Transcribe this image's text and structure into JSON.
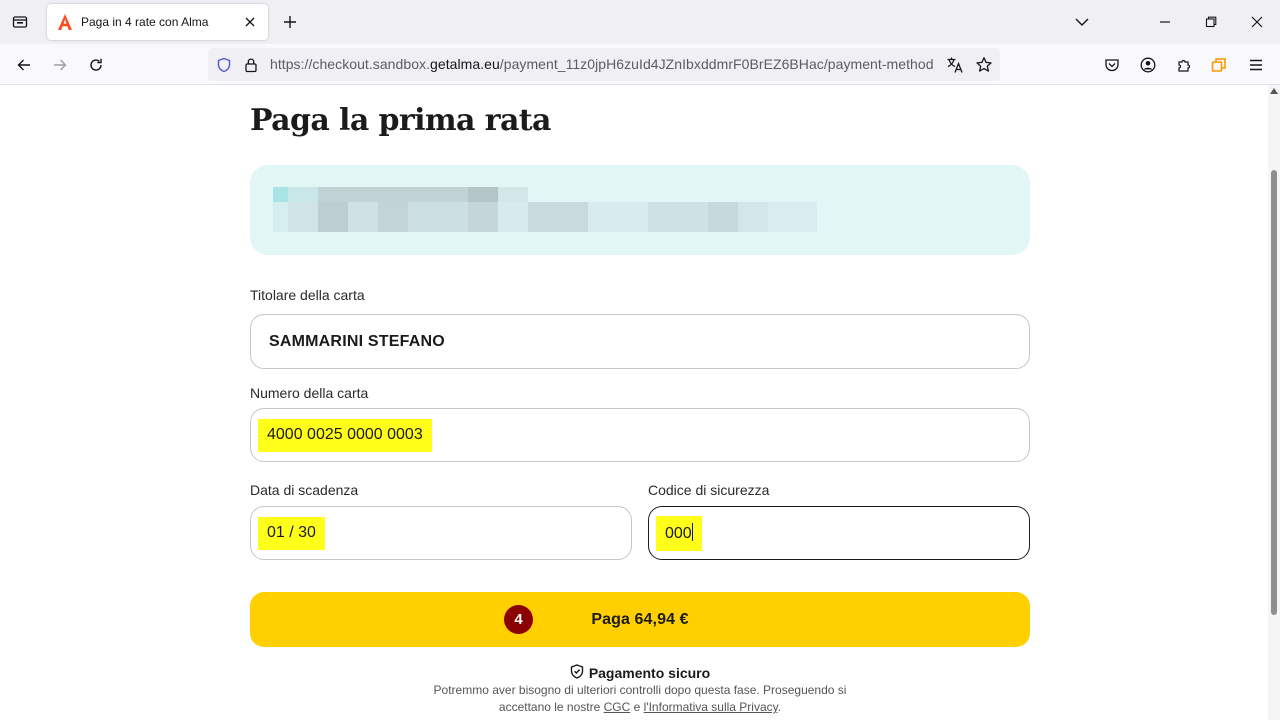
{
  "browser": {
    "tab": {
      "title": "Paga in 4 rate con Alma",
      "favicon": "alma-logo-icon"
    },
    "url": {
      "prefix": "https://checkout.sandbox.",
      "domain": "getalma.eu",
      "path": "/payment_11z0jpH6zuId4JZnIbxddmrF0BrEZ6BHac/payment-method"
    },
    "colors": {
      "tabbar": "#f0f0f4",
      "navbar": "#f9f9fb",
      "urlbar": "#f0f0f4"
    }
  },
  "page": {
    "title": "Paga la prima rata",
    "summary_card": {
      "state": "redacted/pixelated",
      "color": "#e2f6f6"
    },
    "card_holder": {
      "label": "Titolare della carta",
      "value": "SAMMARINI STEFANO"
    },
    "card_number": {
      "label": "Numero della carta",
      "value": "4000 0025 0000 0003"
    },
    "expiry": {
      "label": "Data di scadenza",
      "value": "01 / 30"
    },
    "cvc": {
      "label": "Codice di sicurezza",
      "value": "000"
    },
    "pay_button": {
      "badge": "4",
      "label": "Paga 64,94 €",
      "color": "#ffcf00",
      "badge_color": "#8b0000"
    },
    "secure": {
      "label": "Pagamento sicuro"
    },
    "legal": {
      "line1": "Potremmo aver bisogno di ulteriori controlli dopo questa fase. Proseguendo si",
      "pre": "accettano le nostre ",
      "cgc": "CGC",
      "mid": " e ",
      "privacy": "l'Informativa sulla Privacy",
      "post": "."
    },
    "highlight_color": "#ffff1a"
  }
}
